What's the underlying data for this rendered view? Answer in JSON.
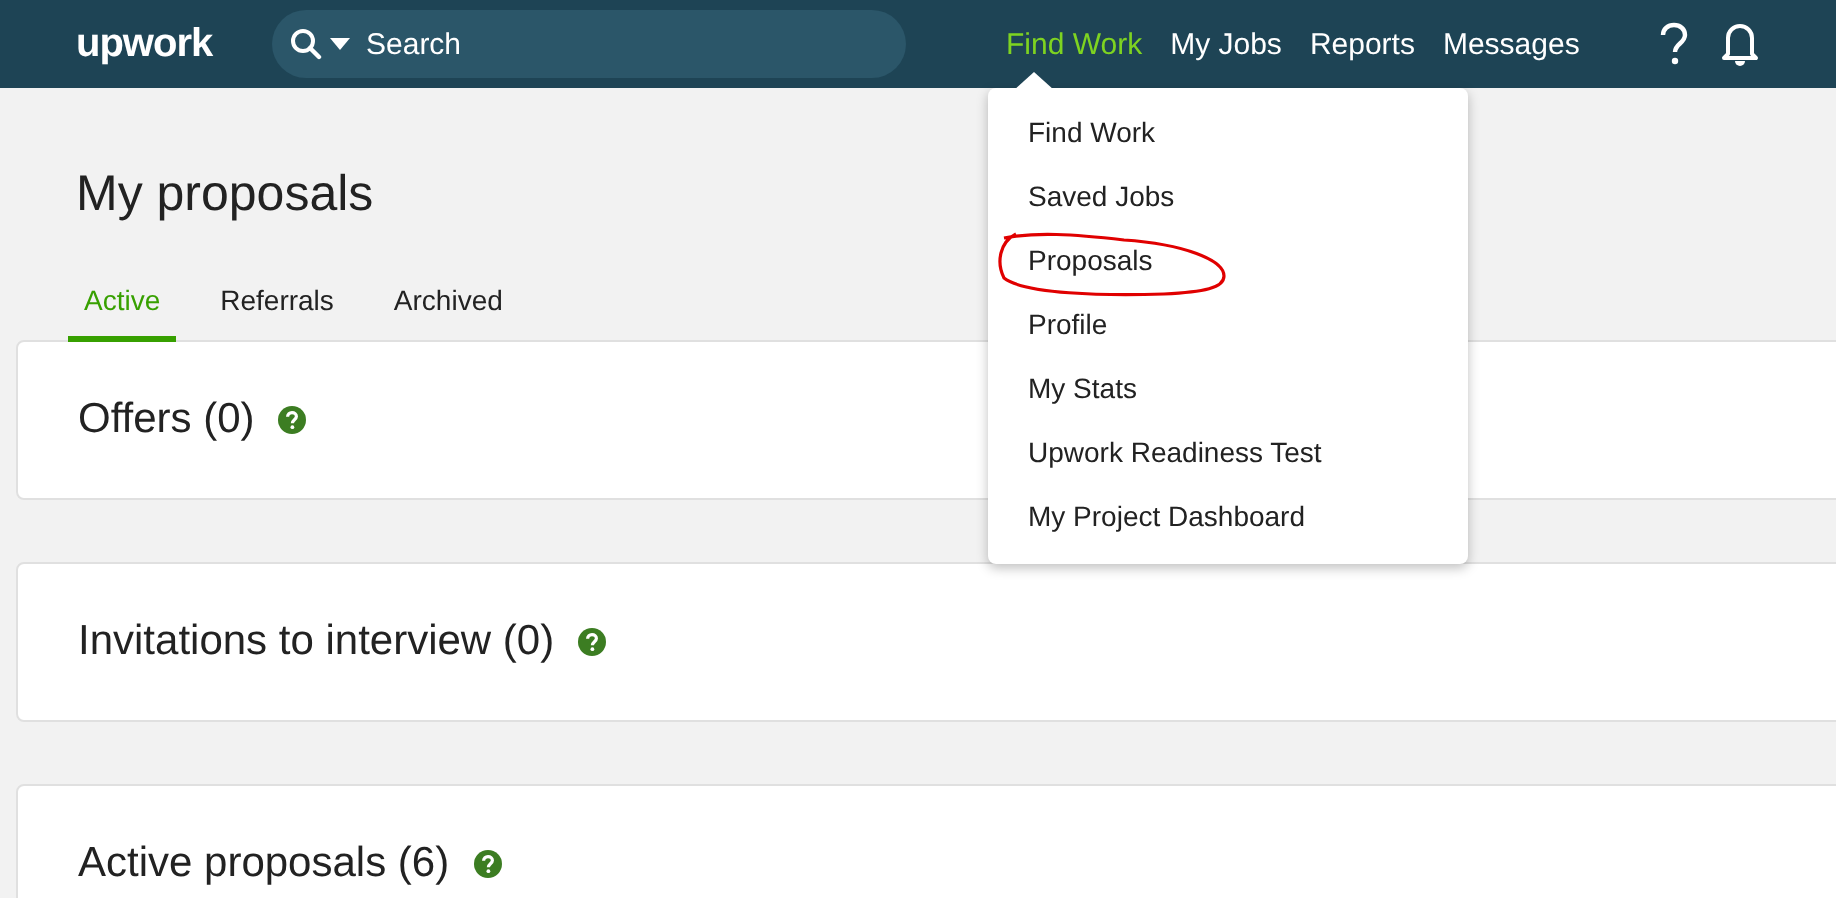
{
  "header": {
    "logo": "upwork",
    "search": {
      "placeholder": "Search"
    },
    "nav": [
      {
        "label": "Find Work",
        "selected": true
      },
      {
        "label": "My Jobs",
        "selected": false
      },
      {
        "label": "Reports",
        "selected": false
      },
      {
        "label": "Messages",
        "selected": false
      }
    ]
  },
  "dropdown": {
    "items": [
      {
        "label": "Find Work",
        "circled": false
      },
      {
        "label": "Saved Jobs",
        "circled": false
      },
      {
        "label": "Proposals",
        "circled": true
      },
      {
        "label": "Profile",
        "circled": false
      },
      {
        "label": "My Stats",
        "circled": false
      },
      {
        "label": "Upwork Readiness Test",
        "circled": false
      },
      {
        "label": "My Project Dashboard",
        "circled": false
      }
    ]
  },
  "page": {
    "title": "My proposals",
    "tabs": [
      {
        "label": "Active",
        "selected": true
      },
      {
        "label": "Referrals",
        "selected": false
      },
      {
        "label": "Archived",
        "selected": false
      }
    ],
    "sections": [
      {
        "heading": "Offers (0)"
      },
      {
        "heading": "Invitations to interview (0)"
      },
      {
        "heading": "Active proposals (6)"
      }
    ]
  }
}
